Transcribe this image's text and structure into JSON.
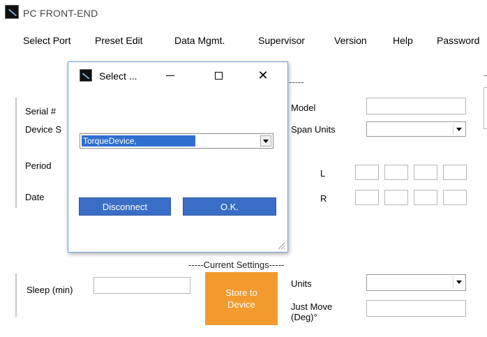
{
  "window": {
    "title": "PC FRONT-END"
  },
  "menu": [
    "Select Port",
    "Preset Edit",
    "Data Mgmt.",
    "Supervisor",
    "Version",
    "Help",
    "Password"
  ],
  "form": {
    "serial_label": "Serial #",
    "device_label": "Device S",
    "period_label": "Period",
    "date_label": "Date",
    "model_label": "Model",
    "span_units_label": "Span Units",
    "l_label": "L",
    "r_label": "R",
    "top_dashes": "-----",
    "current_settings": "-----Current Settings-----",
    "sleep_label": "Sleep (min)",
    "units_label": "Units",
    "just_move_label": "Just Move\n(Deg)°",
    "store_button": "Store to\nDevice"
  },
  "dialog": {
    "title": "Select ...",
    "selected_device": "TorqueDevice,",
    "disconnect_label": "Disconnect",
    "ok_label": "O.K.",
    "close_glyph": "✕"
  }
}
